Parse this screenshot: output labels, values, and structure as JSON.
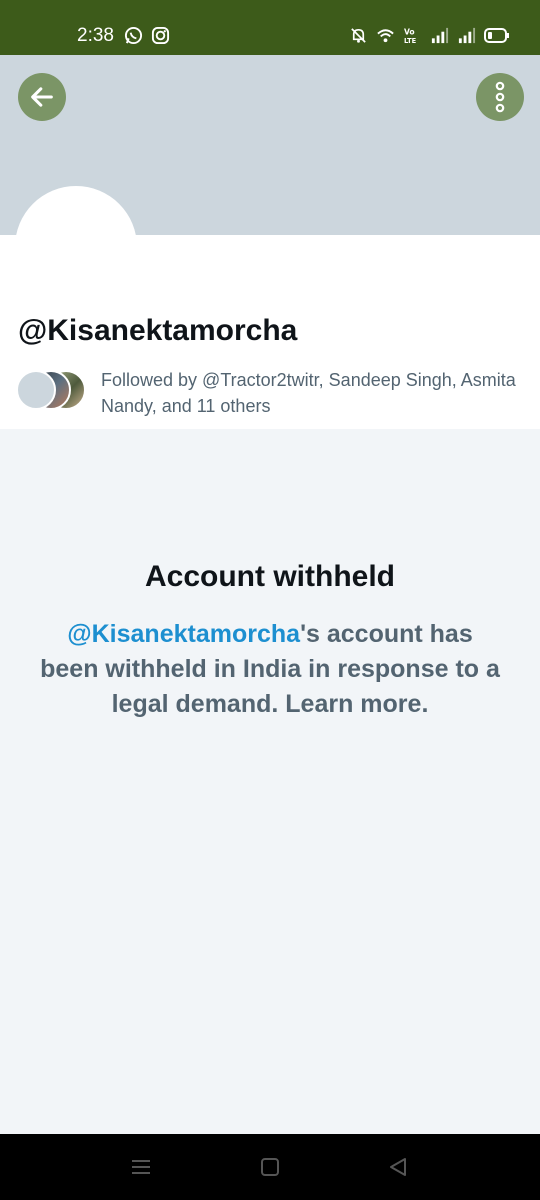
{
  "status_bar": {
    "time": "2:38",
    "icons": [
      "whatsapp-icon",
      "instagram-icon",
      "mute-icon",
      "wifi-icon",
      "volte-icon",
      "signal-icon",
      "signal-icon",
      "battery-icon"
    ]
  },
  "colors": {
    "status_bar_bg": "#3d5b1a",
    "banner_bg": "#ccd6dd",
    "button_bg": "#7b9566",
    "link": "#1d8fd0",
    "muted_text": "#536471",
    "page_bg": "#f2f5f8"
  },
  "header": {
    "back_icon": "arrow-left-icon",
    "more_icon": "more-vertical-icon"
  },
  "profile": {
    "handle": "@Kisanektamorcha",
    "followed_by": "Followed by @Tractor2twitr, Sandeep Singh, Asmita Nandy, and 11 others"
  },
  "withheld": {
    "title": "Account withheld",
    "handle": "@Kisanektamorcha",
    "message": "'s account has been withheld in India in response to a legal demand.",
    "learn_more": "Learn more."
  },
  "nav_bar": {
    "icons": [
      "menu-icon",
      "home-square-icon",
      "back-triangle-icon"
    ]
  }
}
